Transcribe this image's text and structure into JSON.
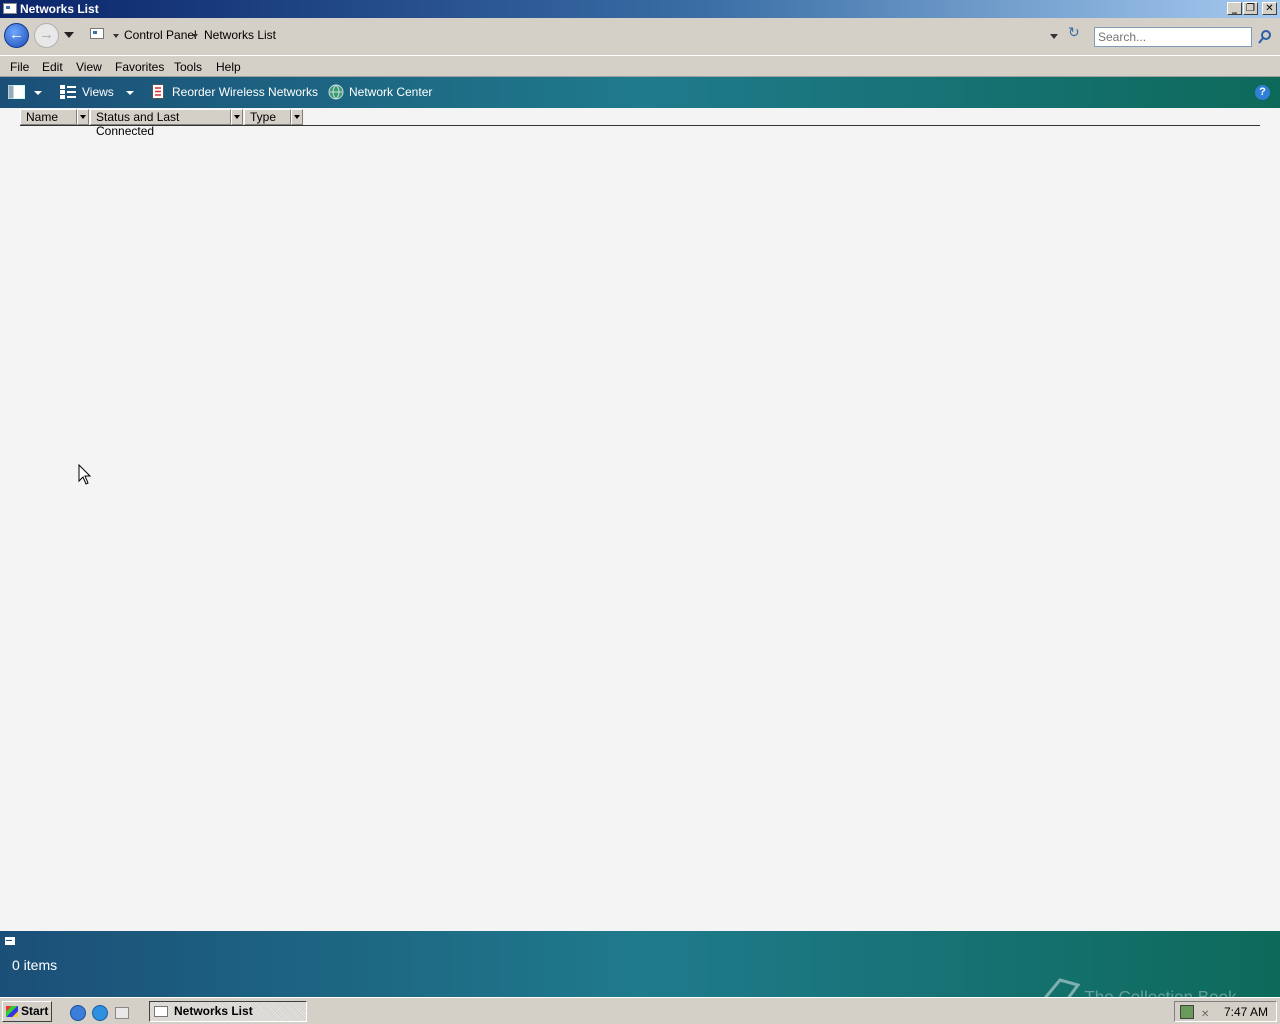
{
  "window": {
    "title": "Networks List"
  },
  "address": {
    "crumbs": [
      "Control Panel",
      "Networks List"
    ]
  },
  "search": {
    "placeholder": "Search..."
  },
  "menubar": {
    "items": [
      "File",
      "Edit",
      "View",
      "Favorites",
      "Tools",
      "Help"
    ]
  },
  "toolbar": {
    "views_label": "Views",
    "reorder_label": "Reorder Wireless Networks",
    "network_center_label": "Network Center"
  },
  "columns": [
    "Name",
    "Status and Last Connected",
    "Type"
  ],
  "details": {
    "item_count": "0 items"
  },
  "taskbar": {
    "start_label": "Start",
    "task_label": "Networks List",
    "clock": "7:47 AM"
  },
  "watermark": "The Collection Book",
  "colors": {
    "accent": "#1f7a8c",
    "title_gradient_start": "#0a246a"
  }
}
